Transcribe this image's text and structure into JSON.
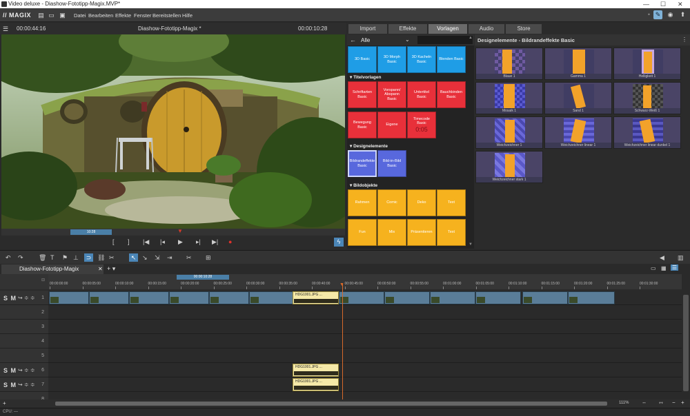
{
  "titlebar": {
    "title": "Video deluxe - Diashow-Fototipp-Magix.MVP*"
  },
  "menubar": {
    "logo": "// MAGIX",
    "items": [
      "Datei",
      "Bearbeiten",
      "Effekte",
      "Fenster",
      "Bereitstellen",
      "Hilfe"
    ]
  },
  "preview": {
    "timecode_left": "00:00:44:16",
    "title": "Diashow-Fototipp-Magix *",
    "timecode_right": "00:00:10:28",
    "scrub_label": "10:28"
  },
  "tabs": [
    "Import",
    "Effekte",
    "Vorlagen",
    "Audio",
    "Store"
  ],
  "active_tab": "Vorlagen",
  "catpanel": {
    "filter": "Alle",
    "top_tiles": [
      "3D Basic",
      "3D Morph Basic",
      "3D Kacheln Basic",
      "Blenden Basic"
    ],
    "sections": {
      "titel": "Titelvorlagen",
      "design": "Designelemente",
      "bild": "Bildobjekte"
    },
    "titel_tiles": [
      "Schriftarten Basic",
      "Vorspann/ Abspann Basic",
      "Untertitel Basic",
      "Bauchbinden Basic",
      "Bewegung Basic",
      "Eigene",
      "Timecode Basic"
    ],
    "timecode_display": "0:05",
    "design_tiles": [
      "Bildrandeffekte Basic",
      "Bild-in-Bild Basic"
    ],
    "bild_tiles": [
      "Rahmen",
      "Comic",
      "Deko",
      "Text",
      "Fun",
      "Mix",
      "Präsentieren",
      "Text"
    ]
  },
  "fxpanel": {
    "header": "Designelemente - Bildrandeffekte Basic",
    "items": [
      "Blaue 1",
      "Gamma 1",
      "Helligkeit 1",
      "Mosaik 1",
      "Sand 1",
      "Schwarz-Weiß 1",
      "Weichzeichner 1",
      "Weichzeichner linear 1",
      "Weichzeichner linear dunkel 1",
      "Weichzeichner stark 1"
    ]
  },
  "timeline": {
    "project_tab": "Diashow-Fototipp-Magix",
    "range_label": "00:00:10:28",
    "ruler_ticks": [
      "00:00:00:00",
      "00:00:05:00",
      "00:00:10:00",
      "00:00:15:00",
      "00:00:20:00",
      "00:00:25:00",
      "00:00:30:00",
      "00:00:35:00",
      "00:00:40:00",
      "00:00:45:00",
      "00:00:50:00",
      "00:00:55:00",
      "00:01:00:00",
      "00:01:05:00",
      "00:01:10:00",
      "00:01:15:00",
      "00:01:20:00",
      "00:01:25:00",
      "00:01:30:00"
    ],
    "tracks": [
      "1",
      "2",
      "3",
      "4",
      "5",
      "6",
      "7",
      "8"
    ],
    "track_ctrl": "S M",
    "clip_name": "HDG1001.JPG",
    "clip_name_short": "HDG1001.JPG ...",
    "zoom": "111%"
  },
  "status": {
    "text": "CPU: —"
  }
}
